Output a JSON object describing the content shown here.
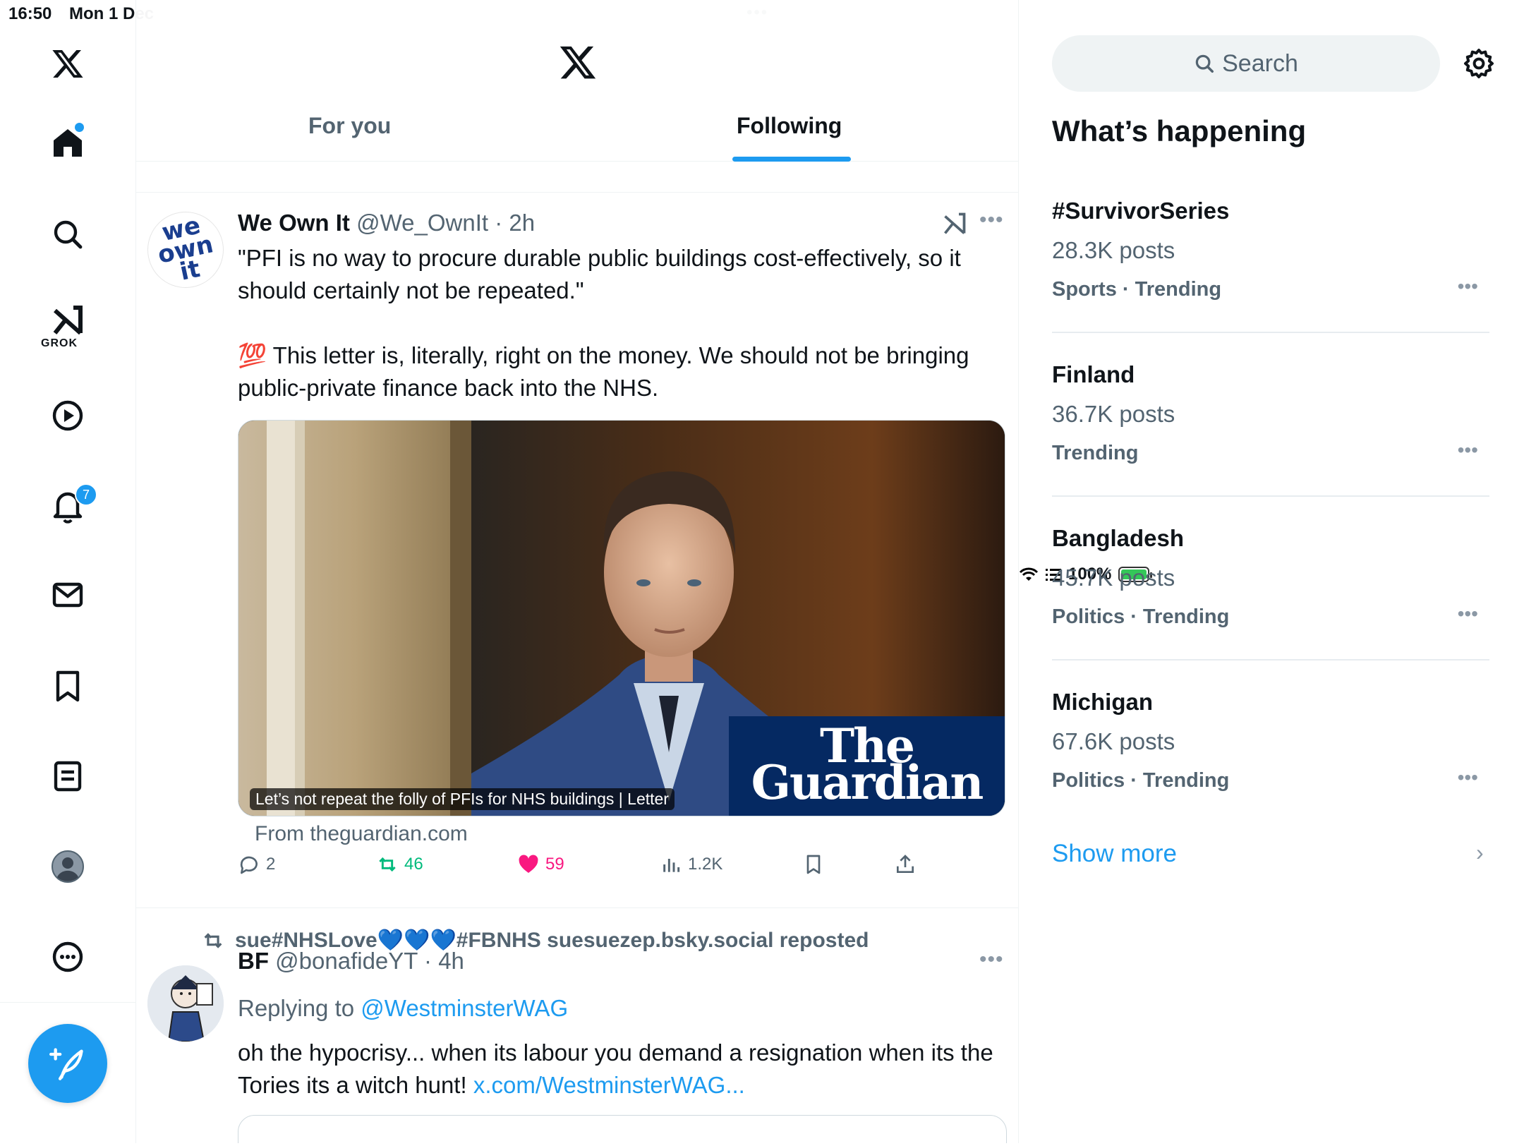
{
  "status_bar": {
    "time": "16:50",
    "date": "Mon 1 Dec",
    "multitask_dots": "•••",
    "battery": "100%"
  },
  "nav": {
    "grok_label": "GROK",
    "notifications_badge": "7",
    "items": [
      "x-logo",
      "home",
      "search",
      "grok",
      "video",
      "notifications",
      "messages",
      "bookmarks",
      "lists",
      "profile",
      "more"
    ]
  },
  "header": {
    "tabs": [
      {
        "label": "For you",
        "selected": false
      },
      {
        "label": "Following",
        "selected": true
      }
    ]
  },
  "tweet1": {
    "name": "We Own It",
    "handle": "@We_OwnIt",
    "time": "· 2h",
    "avatar_text": "we own it",
    "text_line1": "\"PFI is no way to procure durable public buildings cost-effectively, so it should certainly not be repeated.\"",
    "emoji": "💯",
    "text_line2": " This letter is, literally, right on the money. We should not be bringing public-private finance back into the NHS.",
    "card_caption": "Let’s not repeat the folly of PFIs for NHS buildings | Letter",
    "card_brand": "The Guardian",
    "card_source": "From theguardian.com",
    "replies": "2",
    "reposts": "46",
    "likes": "59",
    "views": "1.2K"
  },
  "tweet2": {
    "reposted_by": "sue#NHSLove💙💙💙#FBNHS suesuezep.bsky.social reposted",
    "name": "BF",
    "handle": "@bonafideYT",
    "time": "· 4h",
    "replying_prefix": "Replying to ",
    "replying_to": "@WestminsterWAG",
    "text": "oh the hypocrisy... when its labour you demand a resignation when its the Tories its a witch hunt! ",
    "link": "x.com/WestminsterWAG..."
  },
  "sidebar": {
    "search_placeholder": "Search",
    "title": "What’s happening",
    "trends": [
      {
        "name": "#SurvivorSeries",
        "posts": "28.3K posts",
        "category": "Sports · Trending"
      },
      {
        "name": "Finland",
        "posts": "36.7K posts",
        "category": "Trending"
      },
      {
        "name": "Bangladesh",
        "posts": "45.7K posts",
        "category": "Politics · Trending"
      },
      {
        "name": "Michigan",
        "posts": "67.6K posts",
        "category": "Politics · Trending"
      }
    ],
    "show_more": "Show more"
  },
  "colors": {
    "accent": "#1d9bf0",
    "repost_green": "#00ba7c",
    "like_pink": "#f91880",
    "guardian_blue": "#052962"
  }
}
